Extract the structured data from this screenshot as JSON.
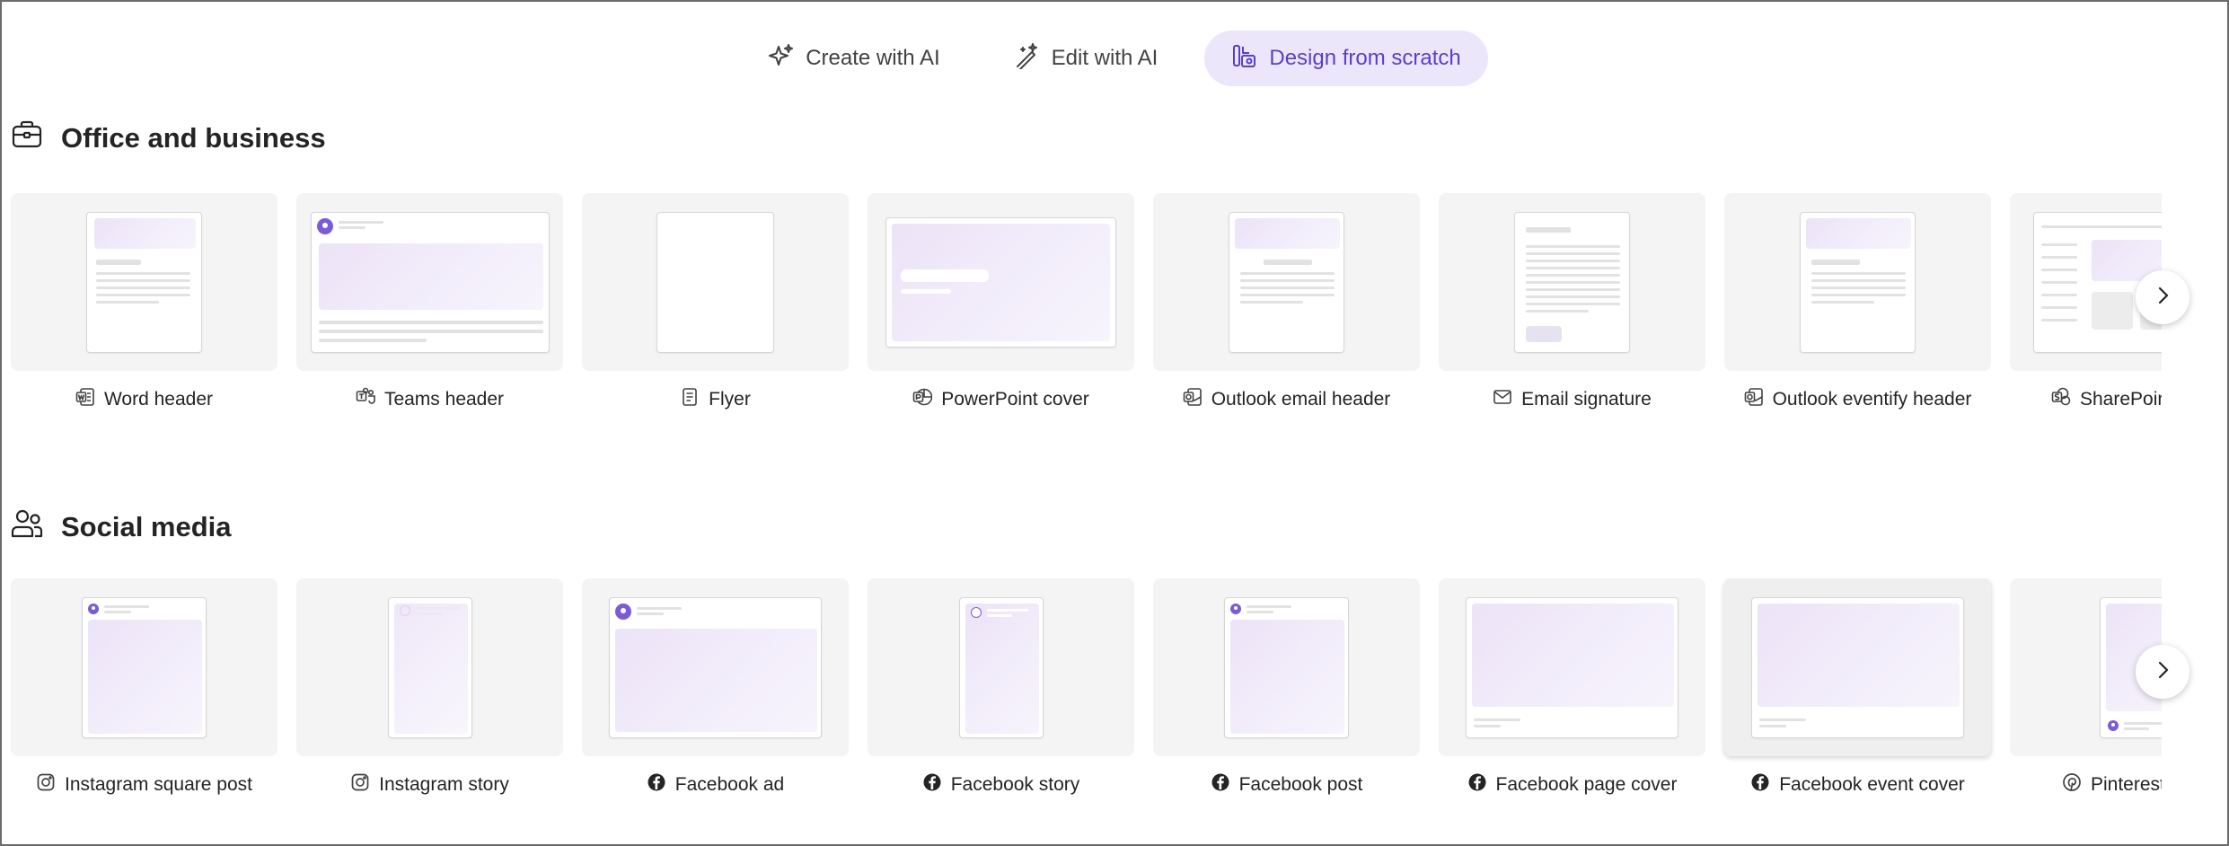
{
  "tabs": [
    {
      "label": "Create with AI",
      "icon": "sparkle-icon",
      "active": false
    },
    {
      "label": "Edit with AI",
      "icon": "magic-wand-icon",
      "active": false
    },
    {
      "label": "Design from scratch",
      "icon": "design-shapes-icon",
      "active": true
    }
  ],
  "sections": {
    "office": {
      "title": "Office and business",
      "icon": "briefcase-icon",
      "items": [
        {
          "label": "Word header",
          "icon": "word-icon"
        },
        {
          "label": "Teams header",
          "icon": "teams-icon"
        },
        {
          "label": "Flyer",
          "icon": "document-icon"
        },
        {
          "label": "PowerPoint cover",
          "icon": "powerpoint-icon"
        },
        {
          "label": "Outlook email header",
          "icon": "outlook-icon"
        },
        {
          "label": "Email signature",
          "icon": "mail-icon"
        },
        {
          "label": "Outlook eventify header",
          "icon": "outlook-icon"
        },
        {
          "label": "SharePoint",
          "icon": "sharepoint-icon"
        }
      ]
    },
    "social": {
      "title": "Social media",
      "icon": "people-icon",
      "items": [
        {
          "label": "Instagram square post",
          "icon": "instagram-icon"
        },
        {
          "label": "Instagram story",
          "icon": "instagram-icon"
        },
        {
          "label": "Facebook ad",
          "icon": "facebook-icon"
        },
        {
          "label": "Facebook story",
          "icon": "facebook-icon"
        },
        {
          "label": "Facebook post",
          "icon": "facebook-icon"
        },
        {
          "label": "Facebook page cover",
          "icon": "facebook-icon"
        },
        {
          "label": "Facebook event cover",
          "icon": "facebook-icon"
        },
        {
          "label": "Pinterest",
          "icon": "pinterest-icon"
        }
      ]
    }
  },
  "colors": {
    "accent": "#5b3fc4",
    "active_tab_bg": "#ece6fb",
    "thumb_bg": "#f4f4f4",
    "preview_lavender": "#ece3f7"
  }
}
